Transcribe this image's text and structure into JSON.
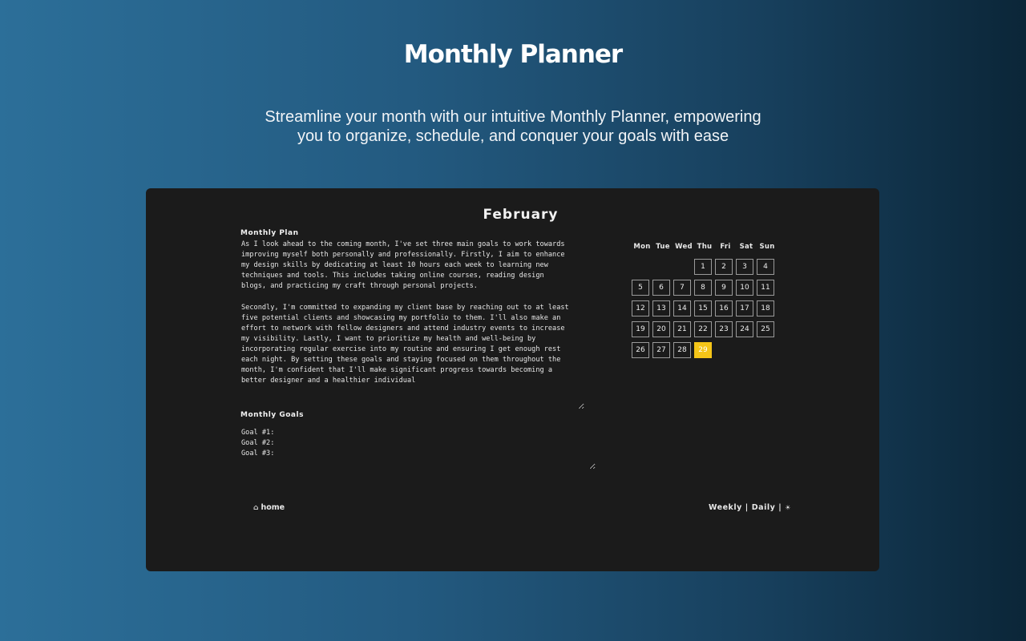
{
  "header": {
    "title": "Monthly Planner",
    "subtitle": "Streamline your month with our intuitive Monthly Planner, empowering you to organize, schedule, and conquer your goals with ease"
  },
  "planner": {
    "month": "February",
    "plan_label": "Monthly Plan",
    "plan_text": "As I look ahead to the coming month, I've set three main goals to work towards\nimproving myself both personally and professionally. Firstly, I aim to enhance\nmy design skills by dedicating at least 10 hours each week to learning new\ntechniques and tools. This includes taking online courses, reading design\nblogs, and practicing my craft through personal projects.\n\nSecondly, I'm committed to expanding my client base by reaching out to at least\nfive potential clients and showcasing my portfolio to them. I'll also make an\neffort to network with fellow designers and attend industry events to increase\nmy visibility. Lastly, I want to prioritize my health and well-being by\nincorporating regular exercise into my routine and ensuring I get enough rest\neach night. By setting these goals and staying focused on them throughout the\nmonth, I'm confident that I'll make significant progress towards becoming a\nbetter designer and a healthier individual",
    "goals_label": "Monthly Goals",
    "goals_text": "Goal #1:\nGoal #2:\nGoal #3:"
  },
  "calendar": {
    "weekdays": [
      "Mon",
      "Tue",
      "Wed",
      "Thu",
      "Fri",
      "Sat",
      "Sun"
    ],
    "leading_blanks": 3,
    "days": [
      "1",
      "2",
      "3",
      "4",
      "5",
      "6",
      "7",
      "8",
      "9",
      "10",
      "11",
      "12",
      "13",
      "14",
      "15",
      "16",
      "17",
      "18",
      "19",
      "20",
      "21",
      "22",
      "23",
      "24",
      "25",
      "26",
      "27",
      "28",
      "29"
    ],
    "today": "29",
    "today_color": "#f5c518"
  },
  "footer": {
    "home_icon": "home-icon",
    "home_label": "home",
    "weekly_label": "Weekly",
    "separator": "|",
    "daily_label": "Daily",
    "theme_icon": "sun-icon"
  }
}
